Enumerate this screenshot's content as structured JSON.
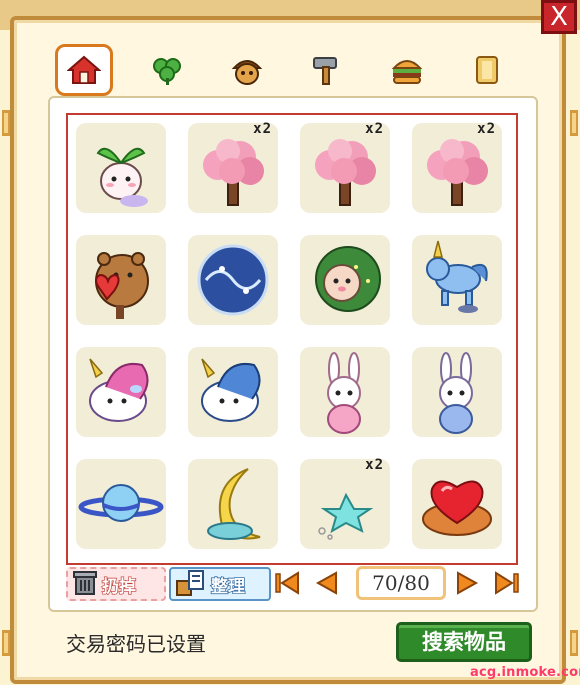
{
  "window": {
    "close_label": "X"
  },
  "tabs": [
    {
      "name": "home-icon",
      "active": true
    },
    {
      "name": "clover-icon",
      "active": false
    },
    {
      "name": "acorn-icon",
      "active": false
    },
    {
      "name": "hammer-icon",
      "active": false
    },
    {
      "name": "burger-icon",
      "active": false
    },
    {
      "name": "scroll-icon",
      "active": false
    }
  ],
  "items": [
    {
      "name": "sprout-doll-item",
      "count": ""
    },
    {
      "name": "cherry-tree-item",
      "count": "x2"
    },
    {
      "name": "cherry-tree-item",
      "count": "x2"
    },
    {
      "name": "cherry-tree-item",
      "count": "x2"
    },
    {
      "name": "bear-heart-item",
      "count": ""
    },
    {
      "name": "galaxy-orb-item",
      "count": ""
    },
    {
      "name": "hedgehog-item",
      "count": ""
    },
    {
      "name": "blue-unicorn-rocker-item",
      "count": ""
    },
    {
      "name": "pink-unicorn-item",
      "count": ""
    },
    {
      "name": "blue-unicorn-item",
      "count": ""
    },
    {
      "name": "pink-bunny-item",
      "count": ""
    },
    {
      "name": "blue-bunny-item",
      "count": ""
    },
    {
      "name": "planet-item",
      "count": ""
    },
    {
      "name": "moon-bed-item",
      "count": ""
    },
    {
      "name": "star-fish-item",
      "count": "x2"
    },
    {
      "name": "heart-cake-item",
      "count": ""
    }
  ],
  "toolbar": {
    "discard_label": "扔掉",
    "sort_label": "整理"
  },
  "pager": {
    "current": "70",
    "total": "80",
    "display": "70/80"
  },
  "status": {
    "text": "交易密码已设置"
  },
  "search_button": {
    "label": "搜索物品"
  },
  "watermark": {
    "text": "acg.inmoke.com"
  },
  "colors": {
    "frame": "#c18b3c",
    "grid_border": "#c33b31",
    "slot_bg": "#f1edd7",
    "search_green": "#2f8a2a",
    "active_tab": "#d8791d"
  }
}
